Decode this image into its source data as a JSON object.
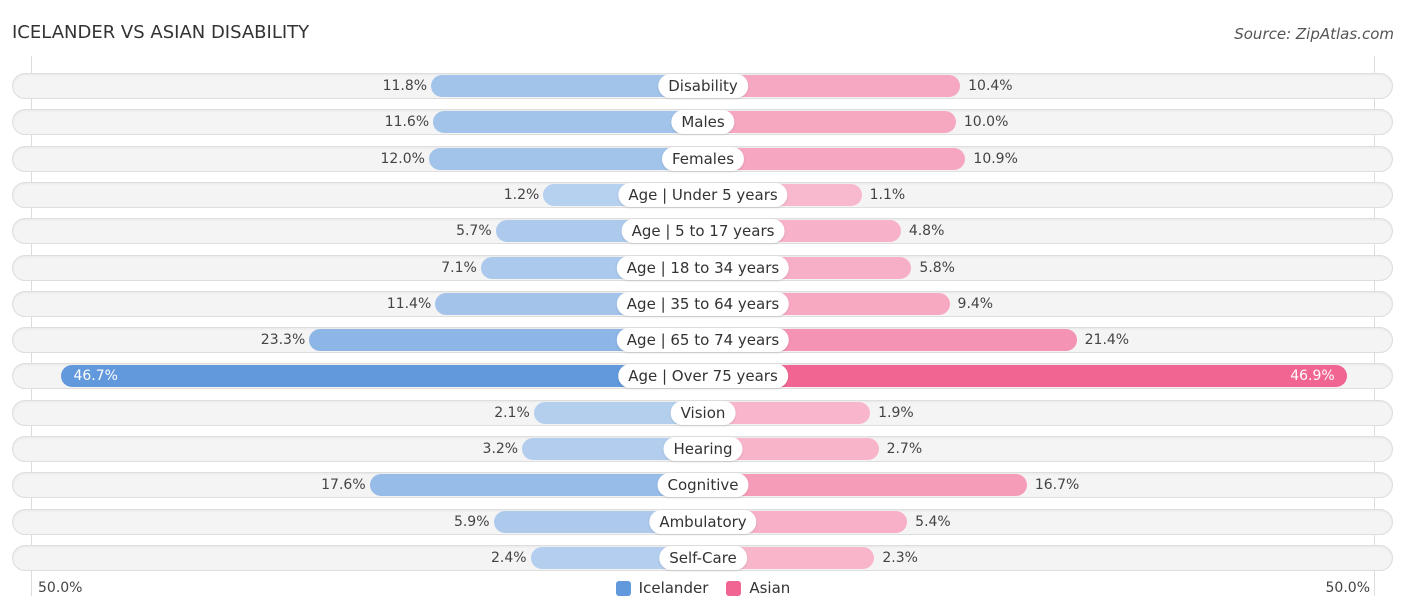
{
  "header": {
    "title": "ICELANDER VS ASIAN DISABILITY",
    "source": "Source: ZipAtlas.com"
  },
  "colors": {
    "icelander": "#6199dc",
    "asian": "#f06592"
  },
  "axis": {
    "left_label": "50.0%",
    "right_label": "50.0%"
  },
  "legend": [
    {
      "name": "Icelander",
      "color": "#6199dc"
    },
    {
      "name": "Asian",
      "color": "#f06592"
    }
  ],
  "chart_data": {
    "type": "bar",
    "orientation": "horizontal-diverging",
    "title": "ICELANDER VS ASIAN DISABILITY",
    "xlabel": "",
    "ylabel": "",
    "xlim": [
      -50,
      50
    ],
    "axis_tick_labels": [
      "50.0%",
      "50.0%"
    ],
    "legend_position": "bottom-center",
    "categories": [
      "Disability",
      "Males",
      "Females",
      "Age | Under 5 years",
      "Age | 5 to 17 years",
      "Age | 18 to 34 years",
      "Age | 35 to 64 years",
      "Age | 65 to 74 years",
      "Age | Over 75 years",
      "Vision",
      "Hearing",
      "Cognitive",
      "Ambulatory",
      "Self-Care"
    ],
    "series": [
      {
        "name": "Icelander",
        "side": "left",
        "values": [
          11.8,
          11.6,
          12.0,
          1.2,
          5.7,
          7.1,
          11.4,
          23.3,
          46.7,
          2.1,
          3.2,
          17.6,
          5.9,
          2.4
        ],
        "labels": [
          "11.8%",
          "11.6%",
          "12.0%",
          "1.2%",
          "5.7%",
          "7.1%",
          "11.4%",
          "23.3%",
          "46.7%",
          "2.1%",
          "3.2%",
          "17.6%",
          "5.9%",
          "2.4%"
        ]
      },
      {
        "name": "Asian",
        "side": "right",
        "values": [
          10.4,
          10.0,
          10.9,
          1.1,
          4.8,
          5.8,
          9.4,
          21.4,
          46.9,
          1.9,
          2.7,
          16.7,
          5.4,
          2.3
        ],
        "labels": [
          "10.4%",
          "10.0%",
          "10.9%",
          "1.1%",
          "4.8%",
          "5.8%",
          "9.4%",
          "21.4%",
          "46.9%",
          "1.9%",
          "2.7%",
          "16.7%",
          "5.4%",
          "2.3%"
        ]
      }
    ]
  }
}
